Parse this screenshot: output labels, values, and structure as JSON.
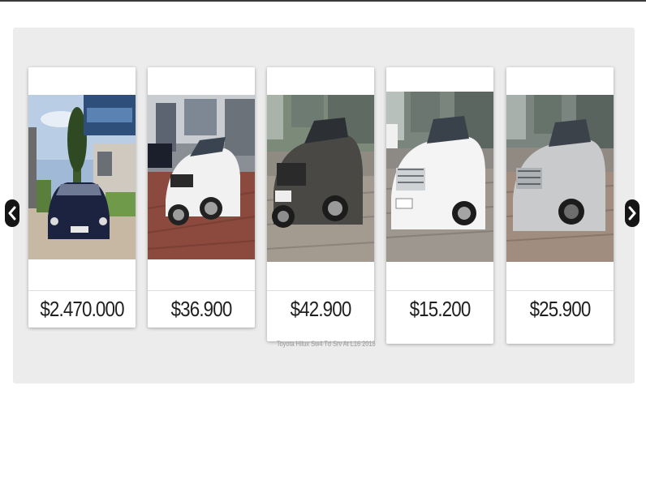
{
  "carousel": {
    "prev_icon": "chevron-left-icon",
    "next_icon": "chevron-right-icon",
    "cars": [
      {
        "price": "$2.470.000",
        "caption": "",
        "photo": "dark sedan in front of dealership sign"
      },
      {
        "price": "$36.900",
        "caption": "",
        "photo": "white SUV on brick pavement"
      },
      {
        "price": "$42.900",
        "caption": "Toyota Hilux Sw4 Td Srv At L16 2018",
        "photo": "grey SUV on cobblestone"
      },
      {
        "price": "$15.200",
        "caption": "",
        "photo": "white sedan on cobblestone"
      },
      {
        "price": "$25.900",
        "caption": "",
        "photo": "silver coupe on cobblestone"
      }
    ]
  },
  "colors": {
    "panel_bg": "#ececec",
    "card_bg": "#ffffff",
    "price_text": "#1f1f1f",
    "caption_text": "#9a9a9a",
    "arrow_bg": "#151515"
  }
}
